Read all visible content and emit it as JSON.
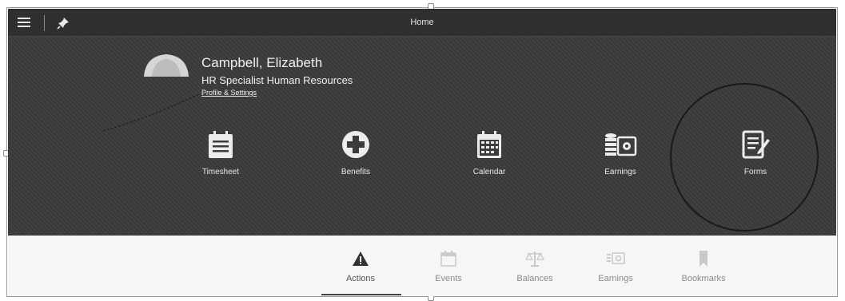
{
  "topbar": {
    "title": "Home",
    "menu_icon": "hamburger-icon",
    "pin_icon": "pin-icon"
  },
  "profile": {
    "name": "Campbell, Elizabeth",
    "role": "HR Specialist Human Resources",
    "settings_link": "Profile & Settings"
  },
  "tiles": [
    {
      "label": "Timesheet",
      "icon": "timesheet-icon"
    },
    {
      "label": "Benefits",
      "icon": "benefits-icon"
    },
    {
      "label": "Calendar",
      "icon": "calendar-icon"
    },
    {
      "label": "Earnings",
      "icon": "earnings-icon"
    },
    {
      "label": "Forms",
      "icon": "forms-icon"
    }
  ],
  "tabs": [
    {
      "label": "Actions",
      "icon": "warning-icon",
      "active": true
    },
    {
      "label": "Events",
      "icon": "calendar-icon",
      "active": false
    },
    {
      "label": "Balances",
      "icon": "scale-icon",
      "active": false
    },
    {
      "label": "Earnings",
      "icon": "money-icon",
      "active": false
    },
    {
      "label": "Bookmarks",
      "icon": "bookmark-icon",
      "active": false
    }
  ],
  "colors": {
    "topbar": "#2f2f2f",
    "hero": "#3b3b3b",
    "tabs_background": "#f6f6f6"
  }
}
